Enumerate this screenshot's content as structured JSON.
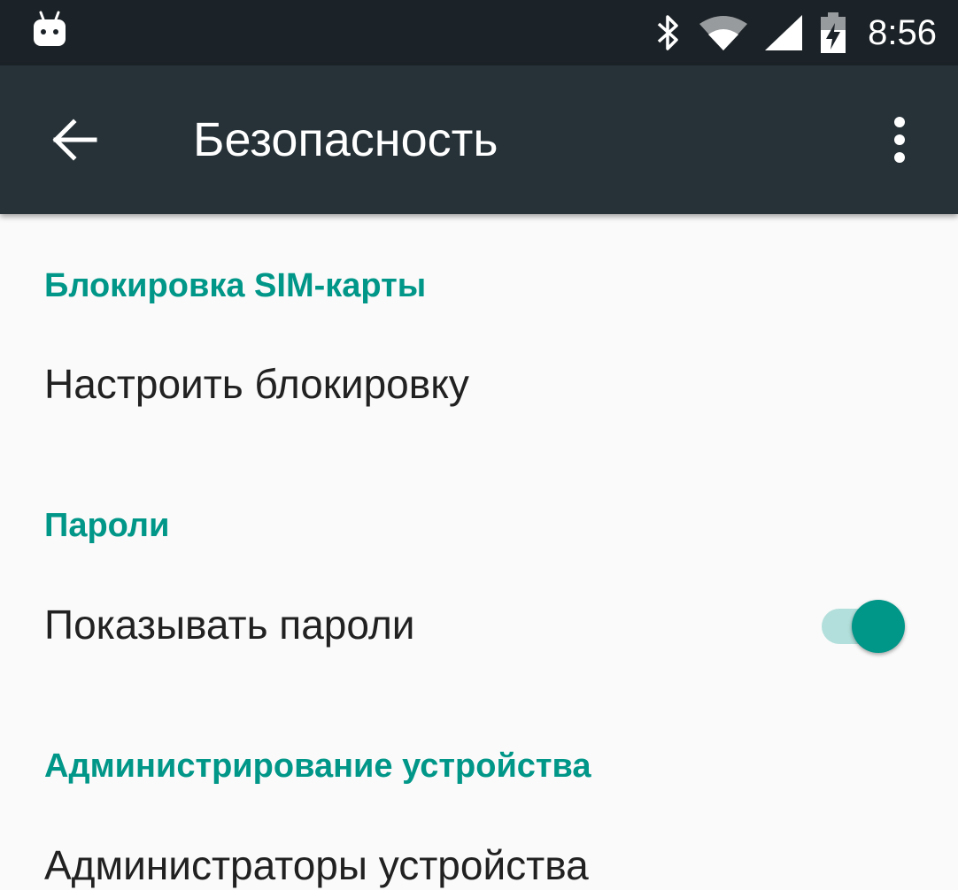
{
  "status_bar": {
    "time": "8:56",
    "notification_icon": "android-robot-icon",
    "icons": [
      "bluetooth-icon",
      "wifi-icon",
      "cell-signal-icon",
      "battery-charging-icon"
    ]
  },
  "toolbar": {
    "back_icon": "arrow-back-icon",
    "title": "Безопасность",
    "overflow_icon": "more-vert-icon",
    "background_color": "#263238"
  },
  "sections": [
    {
      "header": "Блокировка SIM-карты",
      "items": [
        {
          "title": "Настроить блокировку"
        }
      ]
    },
    {
      "header": "Пароли",
      "items": [
        {
          "title": "Показывать пароли",
          "switch_on": true
        }
      ]
    },
    {
      "header": "Администрирование устройства",
      "items": [
        {
          "title": "Администраторы устройства"
        }
      ]
    }
  ],
  "accent_color": "#009688"
}
